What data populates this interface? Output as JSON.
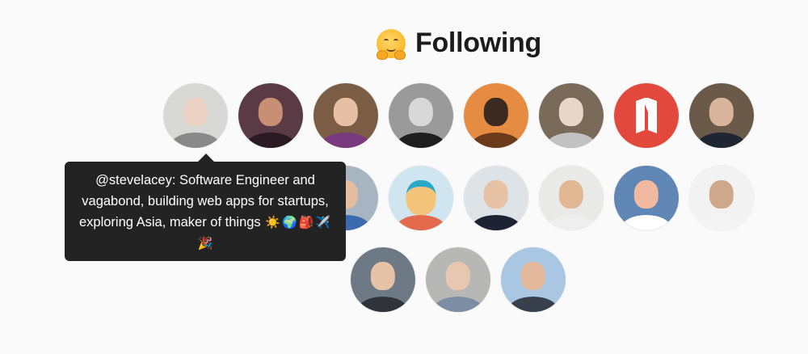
{
  "header": {
    "title": "Following",
    "emoji_icon": "hugging-face-emoji"
  },
  "tooltip": {
    "text": "@stevelacey: Software Engineer and vagabond, building web apps for startups, exploring Asia, maker of things",
    "emojis": [
      "☀️",
      "🌍",
      "🎒",
      "✈️",
      "🎉"
    ]
  },
  "avatars": [
    {
      "name": "avatar-stevelacey",
      "handle": "@stevelacey",
      "hovered": true,
      "bg": "#bdbdb6",
      "skin": "#e3b49a",
      "shirt": "#2d2d2d"
    },
    {
      "name": "avatar-2",
      "bg": "#5a3a45",
      "skin": "#c98f74",
      "shirt": "#2a1a22"
    },
    {
      "name": "avatar-3",
      "bg": "#7b5d46",
      "skin": "#e6bfa4",
      "shirt": "#7a3a7e"
    },
    {
      "name": "avatar-4",
      "bg": "#9a9a9a",
      "skin": "#d8d8d8",
      "shirt": "#1e1e1e"
    },
    {
      "name": "avatar-5",
      "bg": "#e58b42",
      "skin": "#3a2a20",
      "shirt": "#6a3a1a"
    },
    {
      "name": "avatar-6",
      "bg": "#7a6a5a",
      "skin": "#e8d7c9",
      "shirt": "#c2c2c2"
    },
    {
      "name": "avatar-7",
      "bg": "#e3483d",
      "logo": true
    },
    {
      "name": "avatar-8",
      "bg": "#6b5a4a",
      "skin": "#d7b49a",
      "shirt": "#1f2632"
    },
    {
      "name": "avatar-9",
      "bg": "#a7b5c3",
      "skin": "#e4bda0",
      "shirt": "#3b6ab0"
    },
    {
      "name": "avatar-10",
      "bg": "#cfe6f0",
      "skin": "#f3c47a",
      "shirt": "#e36a4c",
      "cartoon": true
    },
    {
      "name": "avatar-11",
      "bg": "#dde3e7",
      "skin": "#e7c2a5",
      "shirt": "#1d2333"
    },
    {
      "name": "avatar-12",
      "bg": "#e9e9e7",
      "skin": "#e2b794",
      "shirt": "#eeeeee"
    },
    {
      "name": "avatar-13",
      "bg": "#5f86b4",
      "skin": "#f0b9a0",
      "shirt": "#ffffff"
    },
    {
      "name": "avatar-14",
      "bg": "#f2f2f2",
      "skin": "#cfa88c",
      "shirt": "#f4f4f4"
    },
    {
      "name": "avatar-15",
      "bg": "#6d7a86",
      "skin": "#e6c2a6",
      "shirt": "#30333a"
    },
    {
      "name": "avatar-16",
      "bg": "#b7b7b5",
      "skin": "#e8c7b0",
      "shirt": "#7c8da4"
    },
    {
      "name": "avatar-17",
      "bg": "#a9c7e2",
      "skin": "#e4b89a",
      "shirt": "#37404c"
    }
  ]
}
